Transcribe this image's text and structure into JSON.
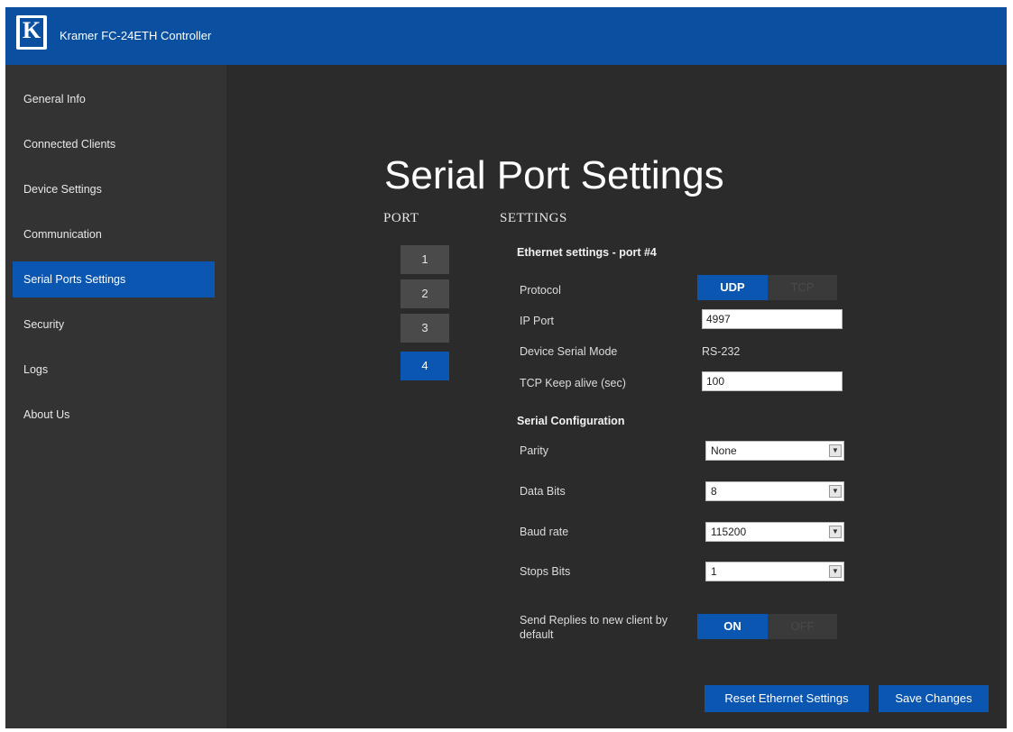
{
  "header": {
    "logo_letter": "K",
    "title": "Kramer FC-24ETH Controller"
  },
  "sidebar": {
    "items": [
      {
        "label": "General Info"
      },
      {
        "label": "Connected Clients"
      },
      {
        "label": "Device Settings"
      },
      {
        "label": "Communication"
      },
      {
        "label": "Serial Ports Settings",
        "active": true
      },
      {
        "label": "Security"
      },
      {
        "label": "Logs"
      },
      {
        "label": "About Us"
      }
    ]
  },
  "main": {
    "title": "Serial Port Settings",
    "port_header": "PORT",
    "settings_header": "SETTINGS",
    "ports": [
      "1",
      "2",
      "3",
      "4"
    ],
    "active_port": "4",
    "ethernet_section": "Ethernet settings - port #4",
    "protocol": {
      "label": "Protocol",
      "option_on": "UDP",
      "option_off": "TCP",
      "selected": "UDP"
    },
    "ip_port": {
      "label": "IP Port",
      "value": "4997"
    },
    "device_serial_mode": {
      "label": "Device Serial Mode",
      "value": "RS-232"
    },
    "tcp_keep_alive": {
      "label": "TCP Keep alive (sec)",
      "value": "100"
    },
    "serial_section": "Serial Configuration",
    "parity": {
      "label": "Parity",
      "value": "None"
    },
    "data_bits": {
      "label": "Data Bits",
      "value": "8"
    },
    "baud_rate": {
      "label": "Baud rate",
      "value": "115200"
    },
    "stop_bits": {
      "label": "Stops Bits",
      "value": "1"
    },
    "send_replies": {
      "label": "Send Replies to new client by default",
      "option_on": "ON",
      "option_off": "OFF",
      "selected": "ON"
    },
    "reset_button": "Reset Ethernet Settings",
    "save_button": "Save Changes"
  },
  "colors": {
    "header_blue": "#0a4fa0",
    "accent_blue": "#0a56b0",
    "background": "#2b2b2b",
    "sidebar": "#333333"
  }
}
